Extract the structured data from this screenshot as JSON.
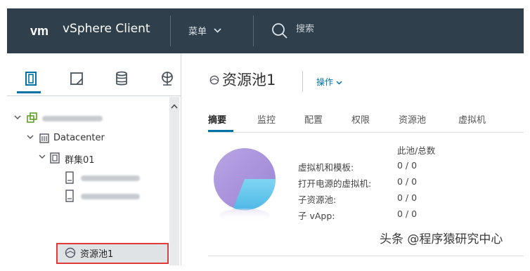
{
  "header": {
    "logo": "vm",
    "app_title": "vSphere Client",
    "menu_label": "菜单",
    "search_placeholder": "搜索"
  },
  "nav_icons": [
    "hosts-clusters-icon",
    "vms-templates-icon",
    "storage-icon",
    "networking-icon"
  ],
  "tree": {
    "datacenter_label": "Datacenter",
    "cluster_label": "群集01",
    "resource_pool_label": "资源池1"
  },
  "main": {
    "title": "资源池1",
    "actions_label": "操作",
    "tabs": [
      "摘要",
      "监控",
      "配置",
      "权限",
      "资源池",
      "虚拟机"
    ],
    "stats_header": "此池/总数",
    "stats": [
      {
        "label": "虚拟机和模板:",
        "value": "0 / 0"
      },
      {
        "label": "打开电源的虚拟机:",
        "value": "0 / 0"
      },
      {
        "label": "子资源池:",
        "value": "0 / 0"
      },
      {
        "label": "子 vApp:",
        "value": "0 / 0"
      }
    ]
  },
  "watermark": "头条 @程序猿研究中心",
  "colors": {
    "header_bg": "#2f3f4c",
    "accent": "#0072a3",
    "selection_border": "#e2393a"
  }
}
